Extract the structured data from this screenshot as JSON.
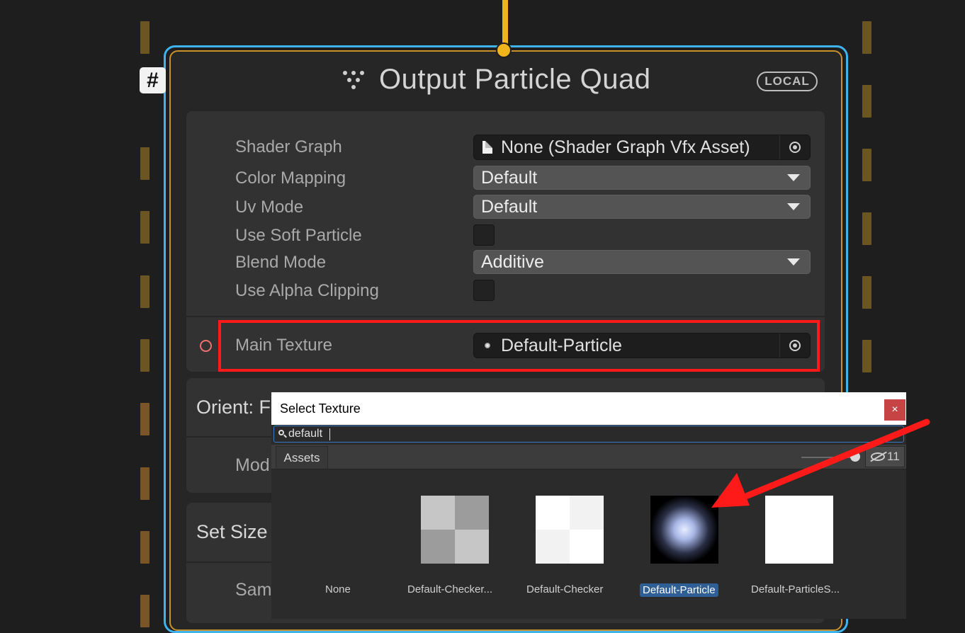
{
  "node": {
    "title": "Output Particle Quad",
    "space_badge": "LOCAL",
    "sticky_badge": "#"
  },
  "settings": {
    "shader_graph": {
      "label": "Shader Graph",
      "value": "None (Shader Graph Vfx Asset)"
    },
    "color_mapping": {
      "label": "Color Mapping",
      "value": "Default"
    },
    "uv_mode": {
      "label": "Uv Mode",
      "value": "Default"
    },
    "use_soft_particle": {
      "label": "Use Soft Particle",
      "checked": false
    },
    "blend_mode": {
      "label": "Blend Mode",
      "value": "Additive"
    },
    "use_alpha_clipping": {
      "label": "Use Alpha Clipping",
      "checked": false
    },
    "main_texture": {
      "label": "Main Texture",
      "value": "Default-Particle"
    }
  },
  "blocks": [
    {
      "title": "Orient: F",
      "sub": "Mod"
    },
    {
      "title": "Set Size",
      "sub": "Sam"
    }
  ],
  "dialog": {
    "title": "Select Texture",
    "close": "×",
    "search_value": "default",
    "tab": "Assets",
    "hidden_count": "11",
    "items": [
      {
        "label": "None",
        "selected": false
      },
      {
        "label": "Default-Checker...",
        "selected": false
      },
      {
        "label": "Default-Checker",
        "selected": false
      },
      {
        "label": "Default-Particle",
        "selected": true
      },
      {
        "label": "Default-ParticleS...",
        "selected": false
      }
    ]
  },
  "colors": {
    "node_border_selected": "#3eb3ee",
    "node_border_context": "#c8912a",
    "flow_link": "#f0b41c",
    "highlight": "#ff1a1a",
    "selection": "#2f5f95"
  }
}
